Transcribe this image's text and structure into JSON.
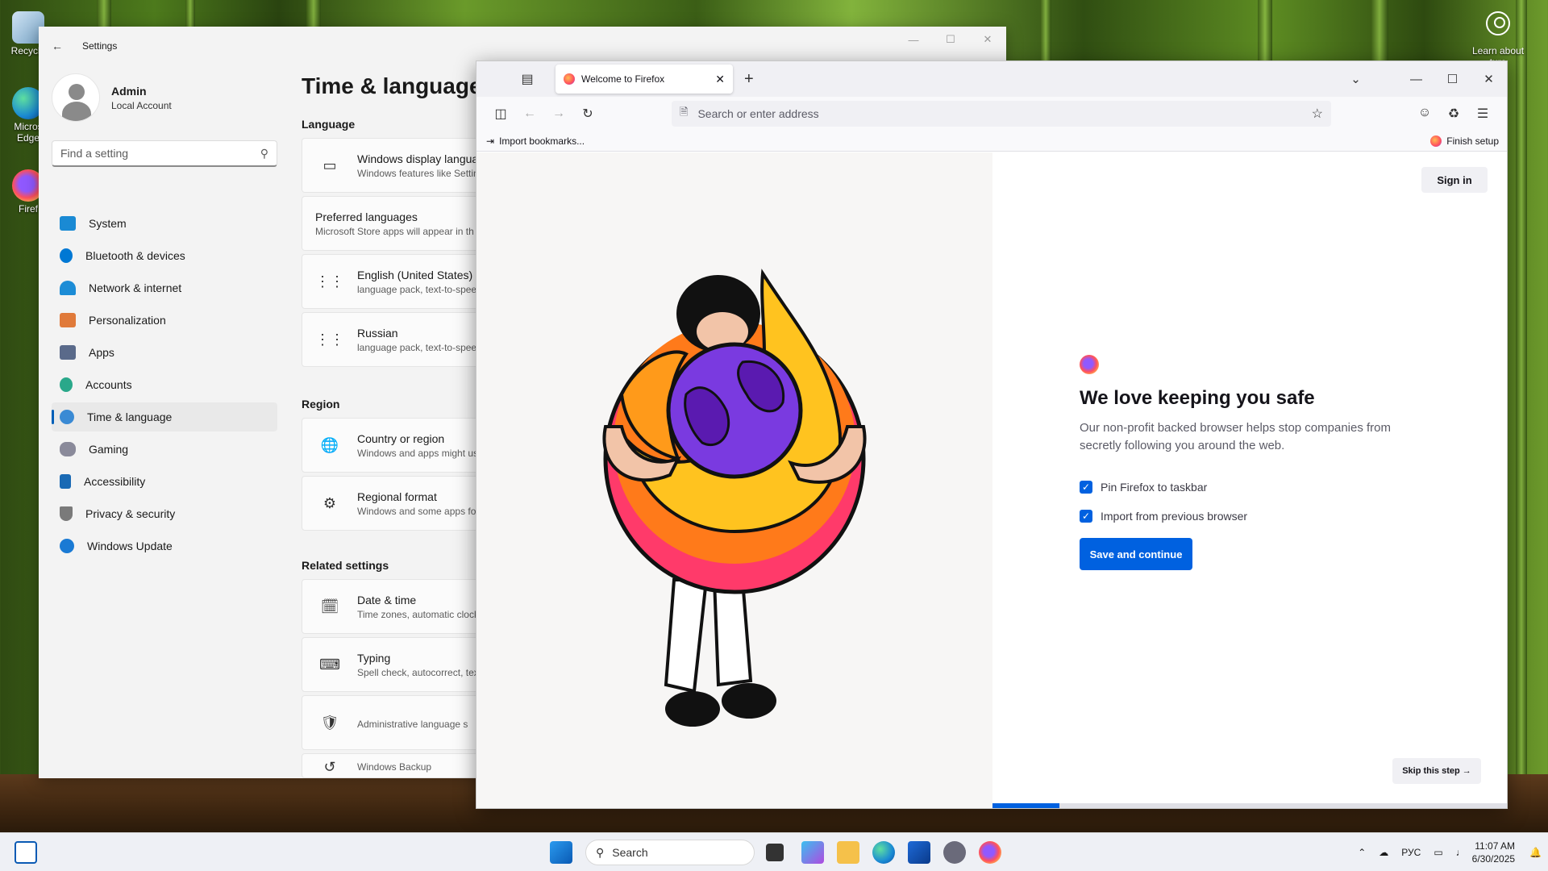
{
  "desktop": {
    "icons": [
      {
        "label": "Recycle"
      },
      {
        "label": "Micros Edge"
      },
      {
        "label": "Firef"
      }
    ],
    "learn_about": "Learn about\nture"
  },
  "settings": {
    "window_title": "Settings",
    "user_name": "Admin",
    "user_type": "Local Account",
    "search_placeholder": "Find a setting",
    "nav": [
      {
        "label": "System",
        "color": "#1a8ad4"
      },
      {
        "label": "Bluetooth & devices",
        "color": "#0078d4"
      },
      {
        "label": "Network & internet",
        "color": "#1c8cd6"
      },
      {
        "label": "Personalization",
        "color": "#e07a3a"
      },
      {
        "label": "Apps",
        "color": "#5a6a8a"
      },
      {
        "label": "Accounts",
        "color": "#2aa88a"
      },
      {
        "label": "Time & language",
        "color": "#3a8ad4"
      },
      {
        "label": "Gaming",
        "color": "#8a8a9a"
      },
      {
        "label": "Accessibility",
        "color": "#1a6ab4"
      },
      {
        "label": "Privacy & security",
        "color": "#7a7a7a"
      },
      {
        "label": "Windows Update",
        "color": "#1a7ad4"
      }
    ],
    "page_title": "Time & language",
    "sections": {
      "language": "Language",
      "region": "Region",
      "related": "Related settings"
    },
    "cards": {
      "display_language": {
        "title": "Windows display languag",
        "desc": "Windows features like Setting"
      },
      "preferred": {
        "title": "Preferred languages",
        "desc": "Microsoft Store apps will appear in th"
      },
      "english": {
        "title": "English (United States)",
        "desc": "language pack, text-to-speec"
      },
      "russian": {
        "title": "Russian",
        "desc": "language pack, text-to-speec"
      },
      "country": {
        "title": "Country or region",
        "desc": "Windows and apps might use"
      },
      "format": {
        "title": "Regional format",
        "desc": "Windows and some apps for"
      },
      "datetime": {
        "title": "Date & time",
        "desc": "Time zones, automatic clock"
      },
      "typing": {
        "title": "Typing",
        "desc": "Spell check, autocorrect, text"
      },
      "admin": {
        "title": "Administrative language s",
        "desc": ""
      },
      "backup": {
        "title": "Windows Backup",
        "desc": ""
      }
    }
  },
  "firefox": {
    "tab_title": "Welcome to Firefox",
    "address_placeholder": "Search or enter address",
    "import_bookmarks": "Import bookmarks...",
    "finish_setup": "Finish setup",
    "sign_in": "Sign in",
    "headline": "We love keeping you safe",
    "subtext": "Our non-profit backed browser helps stop companies from secretly following you around the web.",
    "checkboxes": [
      {
        "label": "Pin Firefox to taskbar",
        "checked": true
      },
      {
        "label": "Import from previous browser",
        "checked": true
      }
    ],
    "primary_button": "Save and continue",
    "skip_button": "Skip this step →",
    "progress": 0.13,
    "accent_color": "#0061e0"
  },
  "taskbar": {
    "search_label": "Search",
    "language_indicator": "РУС",
    "time": "11:07 AM",
    "date": "6/30/2025"
  }
}
